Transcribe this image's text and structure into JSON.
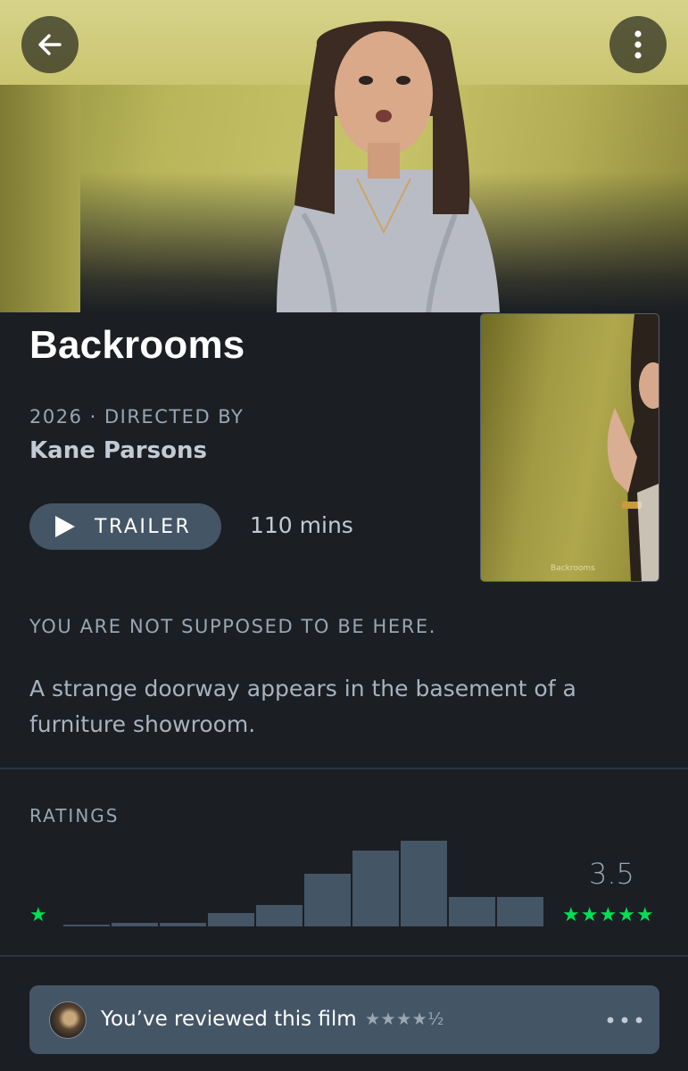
{
  "film": {
    "title": "Backrooms",
    "year_directed": "2026 · DIRECTED BY",
    "director": "Kane Parsons",
    "trailer_label": "TRAILER",
    "runtime": "110 mins",
    "poster_title": "Backrooms",
    "tagline": "YOU ARE NOT SUPPOSED TO BE HERE.",
    "synopsis": "A strange doorway appears in the basement of a furniture showroom."
  },
  "ratings": {
    "label": "RATINGS",
    "average": "3.5",
    "min_star": "★",
    "max_stars": "★★★★★",
    "distribution": [
      1,
      2,
      2,
      7,
      11,
      27,
      39,
      44,
      15,
      15
    ]
  },
  "review": {
    "text": "You’ve reviewed this film",
    "stars": "★★★★½"
  },
  "icons": {
    "back": "arrow-left-icon",
    "more": "more-vertical-icon",
    "play": "play-icon",
    "review_more": "more-horizontal-icon"
  },
  "colors": {
    "background": "#1b1e23",
    "accent_green": "#00e054",
    "button_bg": "#445566",
    "muted_text": "#9aa6b2"
  }
}
